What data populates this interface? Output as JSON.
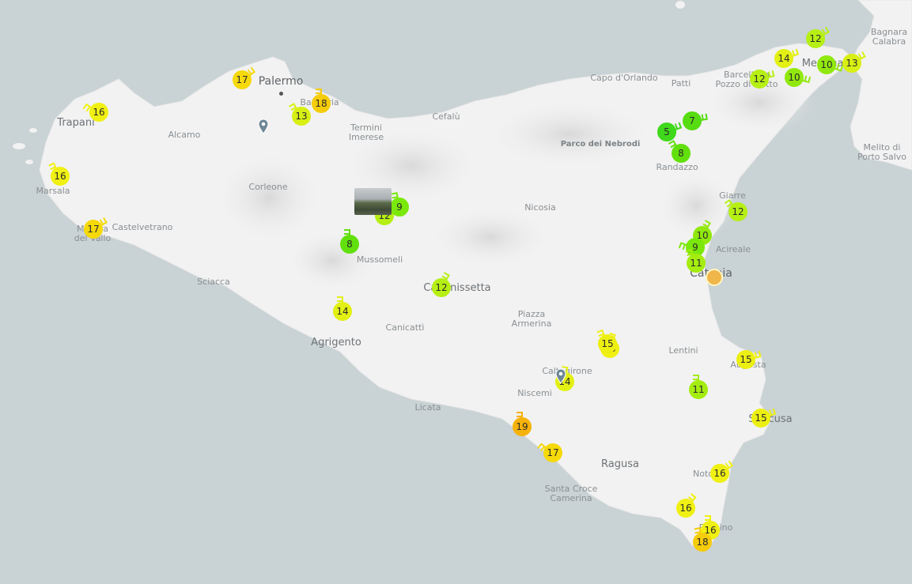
{
  "map": {
    "colors": {
      "sea": "#c9d2d4",
      "land": "#f2f2f2",
      "hills": "#e1e1e1",
      "label": "#8a8f93"
    },
    "places": [
      {
        "name": "Palermo",
        "kind": "city"
      },
      {
        "name": "Bagheria",
        "kind": "town"
      },
      {
        "name": "Trapani",
        "kind": "big"
      },
      {
        "name": "Alcamo",
        "kind": "town"
      },
      {
        "name": "Castelvetrano",
        "kind": "town"
      },
      {
        "name": "Marsala",
        "kind": "town"
      },
      {
        "name": "Mazara\ndel Vallo",
        "kind": "town"
      },
      {
        "name": "Corleone",
        "kind": "town"
      },
      {
        "name": "Termini\nImerese",
        "kind": "town"
      },
      {
        "name": "Cefalù",
        "kind": "town"
      },
      {
        "name": "Mussomeli",
        "kind": "town"
      },
      {
        "name": "Sciacca",
        "kind": "town"
      },
      {
        "name": "Agrigento",
        "kind": "big"
      },
      {
        "name": "Canicattì",
        "kind": "town"
      },
      {
        "name": "Caltanissetta",
        "kind": "big"
      },
      {
        "name": "Nicosia",
        "kind": "town"
      },
      {
        "name": "Piazza\nArmerina",
        "kind": "town"
      },
      {
        "name": "Caltagirone",
        "kind": "town"
      },
      {
        "name": "Niscemi",
        "kind": "town"
      },
      {
        "name": "Licata",
        "kind": "town"
      },
      {
        "name": "Ragusa",
        "kind": "big"
      },
      {
        "name": "Santa Croce\nCamerina",
        "kind": "town"
      },
      {
        "name": "Noto",
        "kind": "town"
      },
      {
        "name": "Pachino",
        "kind": "town"
      },
      {
        "name": "Siracusa",
        "kind": "big"
      },
      {
        "name": "Augusta",
        "kind": "town"
      },
      {
        "name": "Lentini",
        "kind": "town"
      },
      {
        "name": "Catania",
        "kind": "city"
      },
      {
        "name": "Acireale",
        "kind": "town"
      },
      {
        "name": "Giarre",
        "kind": "town"
      },
      {
        "name": "Randazzo",
        "kind": "town"
      },
      {
        "name": "Parco dei Nebrodi",
        "kind": "region"
      },
      {
        "name": "Patti",
        "kind": "town"
      },
      {
        "name": "Capo d'Orlando",
        "kind": "town"
      },
      {
        "name": "Barcellona\nPozzo di Gotto",
        "kind": "town"
      },
      {
        "name": "Messina",
        "kind": "big"
      },
      {
        "name": "Bagnara\nCalabra",
        "kind": "town"
      },
      {
        "name": "Melito di\nPorto Salvo",
        "kind": "town"
      }
    ],
    "stations": [
      {
        "value": "17",
        "color": "#f5d90a"
      },
      {
        "value": "18",
        "color": "#f5cc0a"
      },
      {
        "value": "13",
        "color": "#d8ef14"
      },
      {
        "value": "16",
        "color": "#f0f012"
      },
      {
        "value": "16",
        "color": "#f0f012"
      },
      {
        "value": "17",
        "color": "#f5d90a"
      },
      {
        "value": "12",
        "color": "#b6ef14"
      },
      {
        "value": "9",
        "color": "#7be80c"
      },
      {
        "value": "8",
        "color": "#62e00c"
      },
      {
        "value": "14",
        "color": "#e2f014"
      },
      {
        "value": "12",
        "color": "#b6ef14"
      },
      {
        "value": "5",
        "color": "#3fd81a"
      },
      {
        "value": "7",
        "color": "#56dc10"
      },
      {
        "value": "8",
        "color": "#62e00c"
      },
      {
        "value": "12",
        "color": "#b6ef14"
      },
      {
        "value": "14",
        "color": "#e2f014"
      },
      {
        "value": "12",
        "color": "#b6ef14"
      },
      {
        "value": "10",
        "color": "#91e80e"
      },
      {
        "value": "10",
        "color": "#91e80e"
      },
      {
        "value": "13",
        "color": "#d8ef14"
      },
      {
        "value": "12",
        "color": "#b6ef14"
      },
      {
        "value": "10",
        "color": "#91e80e"
      },
      {
        "value": "9",
        "color": "#7be80c"
      },
      {
        "value": "11",
        "color": "#a5ec10"
      },
      {
        "value": "15",
        "color": "#ecef12"
      },
      {
        "value": "16",
        "color": "#f0f012"
      },
      {
        "value": "14",
        "color": "#e2f014"
      },
      {
        "value": "11",
        "color": "#a5ec10"
      },
      {
        "value": "15",
        "color": "#ecef12"
      },
      {
        "value": "15",
        "color": "#ecef12"
      },
      {
        "value": "19",
        "color": "#f5b20a"
      },
      {
        "value": "17",
        "color": "#f5d90a"
      },
      {
        "value": "16",
        "color": "#f0f012"
      },
      {
        "value": "16",
        "color": "#f0f012"
      },
      {
        "value": "16",
        "color": "#f0f012"
      },
      {
        "value": "18",
        "color": "#f5cc0a"
      }
    ],
    "pins": [
      {
        "icon": "location-pin-icon"
      },
      {
        "icon": "location-pin-icon"
      }
    ],
    "webcam": {
      "icon": "webcam-thumbnail"
    },
    "user_marker": {
      "icon": "smiley-icon"
    }
  }
}
